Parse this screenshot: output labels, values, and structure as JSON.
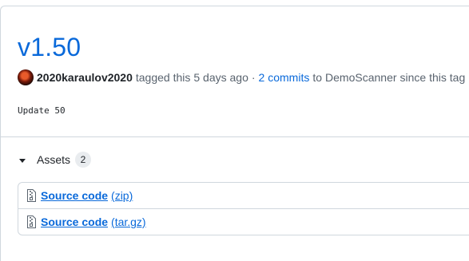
{
  "release": {
    "title": "v1.50",
    "author": "2020karaulov2020",
    "tagged_text": "tagged this",
    "time_ago": "5 days ago",
    "separator": "·",
    "commits_link": "2 commits",
    "to_text": "to",
    "branch": "DemoScanner",
    "since_text": "since this tag",
    "body": "Update 50"
  },
  "assets": {
    "label": "Assets",
    "count": "2",
    "items": [
      {
        "name": "Source code",
        "ext": "(zip)",
        "icon": "file-zip-icon"
      },
      {
        "name": "Source code",
        "ext": "(tar.gz)",
        "icon": "file-zip-icon"
      }
    ]
  },
  "colors": {
    "link": "#0969da",
    "text": "#1f2328",
    "muted": "#59636e",
    "border": "#d0d7de"
  }
}
